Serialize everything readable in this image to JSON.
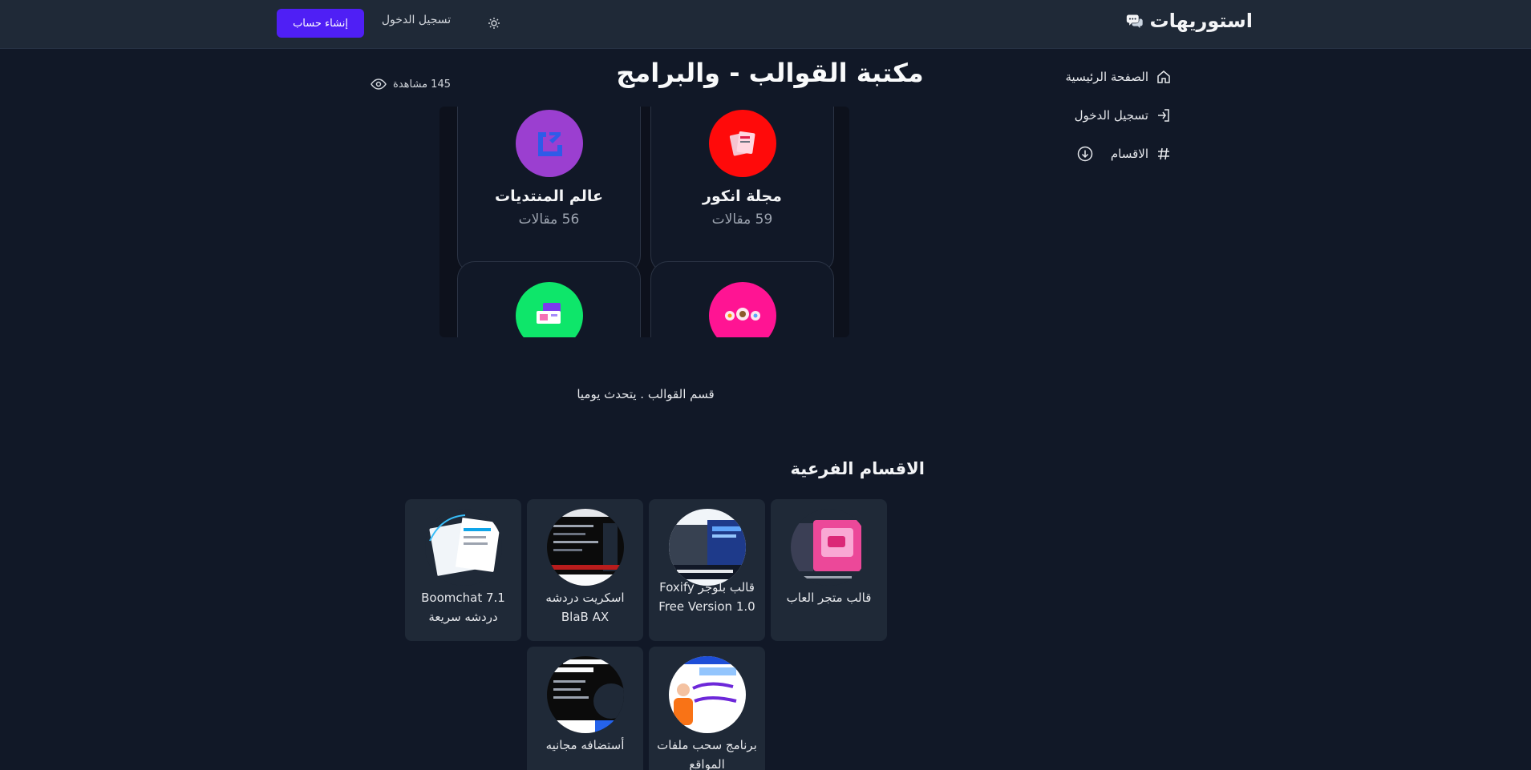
{
  "header": {
    "brand": "استوريهات",
    "signup_label": "إنشاء حساب",
    "login_label": "تسجيل الدخول",
    "brand_icon": "chat-bubbles-icon",
    "theme_icon": "sun-icon"
  },
  "sidebar": {
    "items": [
      {
        "label": "الصفحة الرئيسية",
        "icon": "home-icon"
      },
      {
        "label": "تسجيل الدخول",
        "icon": "login-icon"
      },
      {
        "label": "الاقسام",
        "icon": "hash-icon",
        "trailing_icon": "chevron-down-circle-icon"
      }
    ]
  },
  "main": {
    "title": "مكتبة القوالب - والبرامج",
    "views_label": "145 مشاهدة",
    "carousel": [
      {
        "name": "مجلة انكور",
        "count": "59 مقالات",
        "color": "#ff0a0a"
      },
      {
        "name": "عالم المنتديات",
        "count": "56 مقالات",
        "color": "#9b3fd0"
      },
      {
        "name": "",
        "count": "",
        "color": "#ff1493"
      },
      {
        "name": "",
        "count": "",
        "color": "#0ee66a"
      }
    ],
    "tagline": "قسم القوالب . يتحدث يوميا",
    "subsections_title": "الاقسام الفرعية",
    "subsections": [
      {
        "label": "قالب متجر العاب"
      },
      {
        "label": "قالب بلوجر Foxify Free Version 1.0"
      },
      {
        "label": "اسكريت دردشه BlaB AX"
      },
      {
        "label": "Boomchat 7.1 دردشه سريعة"
      },
      {
        "label": "برنامج سحب ملفات المواقع"
      },
      {
        "label": "أستضافه مجانيه"
      }
    ]
  },
  "colors": {
    "background": "#111827",
    "header_bg": "#1f2937",
    "accent": "#4f1ff5"
  }
}
